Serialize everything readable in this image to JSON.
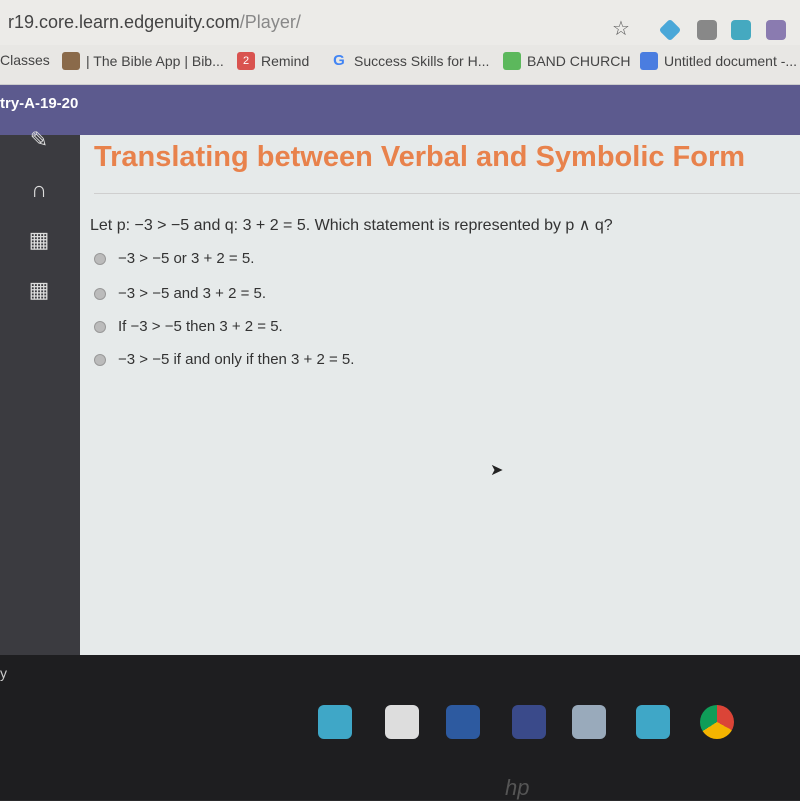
{
  "browser": {
    "url_host": "r19.core.learn.edgenuity.com",
    "url_path": "/Player/",
    "extensions": [
      "diamond-extension-icon",
      "c-extension-icon",
      "cloud-extension-icon",
      "pdf-extension-icon"
    ],
    "bookmarks": [
      {
        "label": "Classes",
        "icon": ""
      },
      {
        "label": "| The Bible App | Bib...",
        "icon": "bible-app-icon",
        "color": "#8a6a4a"
      },
      {
        "label": "Remind",
        "icon": "2",
        "color": "#d9534f"
      },
      {
        "label": "Success Skills for H...",
        "icon": "G",
        "color": "#4285f4"
      },
      {
        "label": "BAND CHURCH",
        "icon": "band-icon",
        "color": "#5cb85c"
      },
      {
        "label": "Untitled document -...",
        "icon": "docs-icon",
        "color": "#4a7de0"
      }
    ]
  },
  "course": {
    "name": "try-A-19-20"
  },
  "lesson": {
    "title": "Translating between Verbal and Symbolic Form",
    "question": "Let p: −3 > −5 and q: 3 + 2 = 5. Which statement is represented by p ∧ q?",
    "options": [
      "−3 > −5 or 3 + 2 = 5.",
      "−3 > −5 and 3 + 2 = 5.",
      "If −3 > −5 then 3 + 2 = 5.",
      "−3 > −5 if and only if then 3 + 2 = 5."
    ]
  },
  "sidebar": {
    "icons": [
      "pencil-icon",
      "headphones-icon",
      "calculator-icon",
      "calculator-icon"
    ]
  },
  "bottom": {
    "partial_label": "y"
  },
  "colors": {
    "accent": "#e8824c",
    "header": "#5c5a8e"
  }
}
